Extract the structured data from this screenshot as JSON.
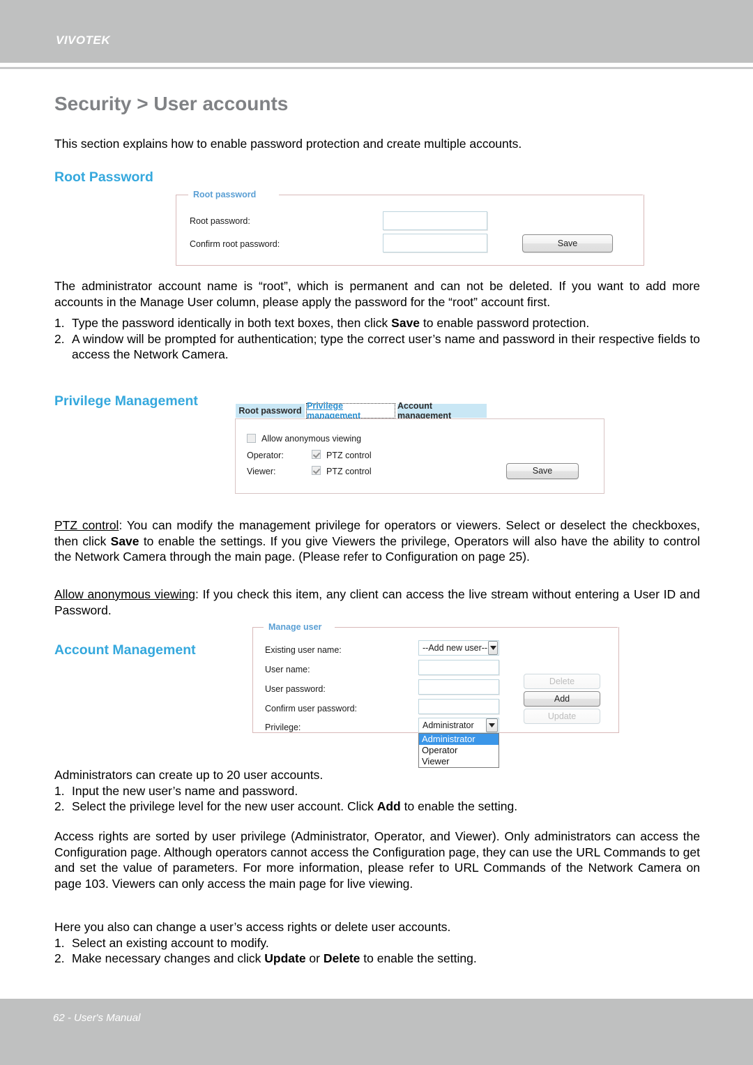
{
  "header": {
    "brand": "VIVOTEK"
  },
  "page": {
    "title": "Security > User accounts",
    "intro": "This section explains how to enable password protection and create multiple accounts."
  },
  "sections": {
    "root_password": {
      "heading": "Root Password",
      "panel": {
        "legend": "Root password",
        "fields": [
          {
            "label": "Root password:",
            "value": "",
            "placeholder": ""
          },
          {
            "label": "Confirm root password:",
            "value": "",
            "placeholder": ""
          }
        ],
        "save_label": "Save"
      },
      "body": "The administrator account name is “root”, which is permanent and can not be deleted. If you want to add more accounts in the Manage User column, please apply the password for the “root” account first.",
      "steps": [
        {
          "num": "1.",
          "text_before": "Type the password identically in both text boxes, then click ",
          "bold": "Save",
          "text_after": " to enable password protection."
        },
        {
          "num": "2.",
          "text_before": "A window will be prompted for authentication; type the correct user’s name and password in their respective fields to access the Network Camera.",
          "bold": "",
          "text_after": ""
        }
      ]
    },
    "privilege_management": {
      "heading": "Privilege Management",
      "panel": {
        "tabs": [
          {
            "label": "Root password",
            "active": false
          },
          {
            "label": "Privilege management",
            "active": true
          },
          {
            "label": "Account management",
            "active": false
          }
        ],
        "anonymous": {
          "label": "Allow anonymous viewing",
          "checked": false
        },
        "rows": [
          {
            "label": "Operator:",
            "checkbox_label": "PTZ control",
            "checked": true
          },
          {
            "label": "Viewer:",
            "checkbox_label": "PTZ control",
            "checked": true
          }
        ],
        "save_label": "Save"
      },
      "ptz_note": {
        "term": "PTZ control",
        "part1": ": You can modify the management privilege for operators or viewers. Select or deselect the checkboxes, then click ",
        "bold": "Save",
        "part2": " to enable the settings. If you give Viewers the privilege, Operators will also have the ability to control the Network Camera through the main page. (Please refer to Configuration on page 25)."
      },
      "anon_note": {
        "term": "Allow anonymous viewing",
        "part1": ": If you check this item, any client can access the live stream without entering a User ID and Password."
      }
    },
    "account_management": {
      "heading": "Account Management",
      "panel": {
        "legend": "Manage user",
        "fields": [
          {
            "label": "Existing user name:",
            "type": "select",
            "value": "--Add new user--"
          },
          {
            "label": "User name:",
            "type": "text",
            "value": ""
          },
          {
            "label": "User password:",
            "type": "text",
            "value": ""
          },
          {
            "label": "Confirm user password:",
            "type": "text",
            "value": ""
          },
          {
            "label": "Privilege:",
            "type": "select",
            "value": "Administrator"
          }
        ],
        "privilege_options": [
          "Administrator",
          "Operator",
          "Viewer"
        ],
        "privilege_selected": "Administrator",
        "buttons": [
          {
            "label": "Delete",
            "disabled": true
          },
          {
            "label": "Add",
            "disabled": false
          },
          {
            "label": "Update",
            "disabled": true
          }
        ]
      },
      "body": "Administrators can create up to 20 user accounts.",
      "steps": [
        {
          "num": "1.",
          "text_before": "Input the new user’s name and password.",
          "bold": "",
          "text_after": ""
        },
        {
          "num": "2.",
          "text_before": "Select the privilege level for the new user account. Click ",
          "bold": "Add",
          "text_after": " to enable the setting."
        }
      ],
      "access_note": "Access rights are sorted by user privilege (Administrator, Operator, and Viewer). Only administrators can access the Configuration page. Although operators cannot access the Configuration page, they can use the URL Commands to get and set the value of parameters. For more information, please refer to URL Commands of the Network Camera on page 103. Viewers can only access the main page for live viewing.",
      "modify_body": "Here you also can change a user’s access rights or delete user accounts.",
      "modify_steps": [
        {
          "num": "1.",
          "text_before": "Select an existing account to modify.",
          "bold": "",
          "text_after": ""
        },
        {
          "num": "2.",
          "text_before": "Make necessary changes and click ",
          "bold": "Update",
          "mid": " or ",
          "bold2": "Delete",
          "text_after": " to enable the setting."
        }
      ]
    }
  },
  "footer": {
    "text": "62 - User's Manual"
  },
  "colors": {
    "heading_blue": "#35a8dd",
    "title_gray": "#808285",
    "header_gray": "#bfc0c0",
    "legend_blue": "#5a9fd4",
    "tab_inactive": "#c9e7f5",
    "dropdown_highlight": "#3b96e8"
  }
}
